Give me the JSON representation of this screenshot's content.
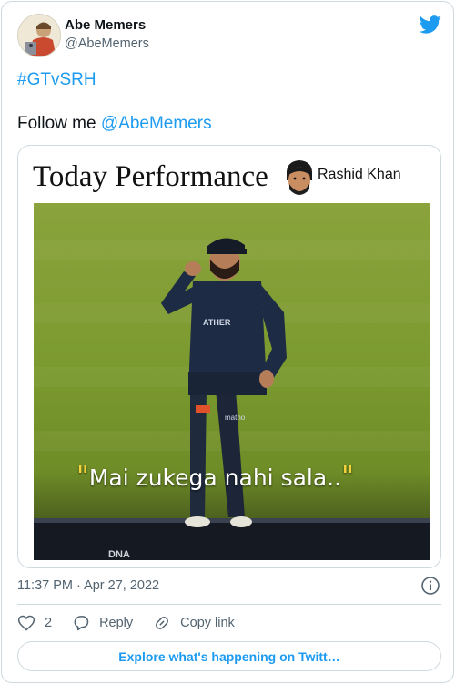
{
  "author": {
    "name": "Abe Memers",
    "handle": "@AbeMemers"
  },
  "tweet": {
    "hashtag": "#GTvSRH",
    "follow_prefix": "Follow me",
    "follow_mention": "@AbeMemers"
  },
  "media": {
    "title": "Today Performance",
    "person_name": "Rashid Khan",
    "caption_open": "\"",
    "caption": "Mai zukega nahi sala..",
    "caption_close": "\""
  },
  "meta": {
    "timestamp": "11:37 PM · Apr 27, 2022"
  },
  "actions": {
    "like_count": "2",
    "reply_label": "Reply",
    "copy_label": "Copy link"
  },
  "explore_label": "Explore what's happening on Twitt…",
  "colors": {
    "accent": "#1d9bf0",
    "muted": "#536471",
    "border": "#cfd9de",
    "field": "#7b9a2f"
  },
  "icons": [
    "twitter-bird-icon",
    "info-icon",
    "heart-icon",
    "reply-icon",
    "link-icon"
  ]
}
